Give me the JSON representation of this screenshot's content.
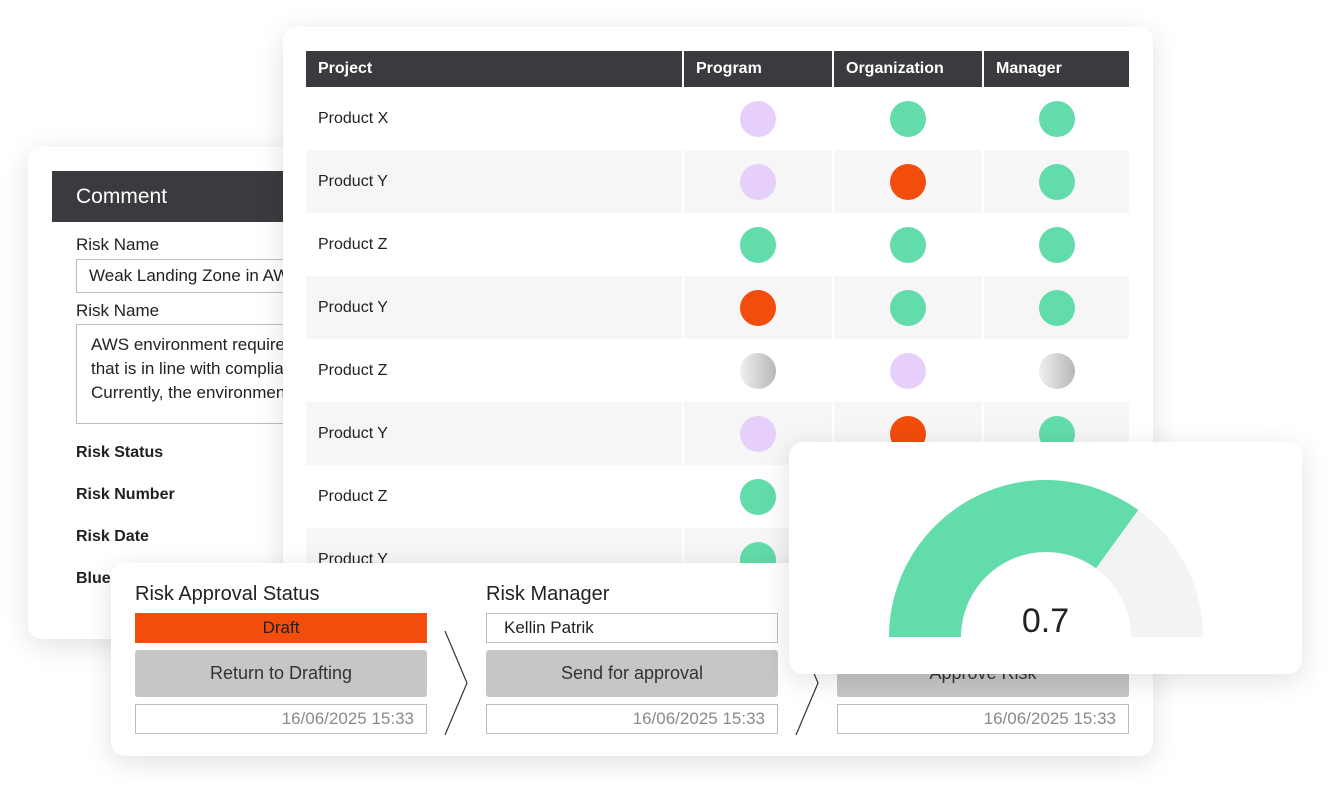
{
  "comment": {
    "header": "Comment",
    "risk_name_label": "Risk Name",
    "risk_name_value": "Weak Landing Zone in AWS",
    "description_label": "Risk Name",
    "description_lines": [
      "AWS environment requires a landing zone",
      "that is in line with compliance standards.",
      "Currently, the environment lacks this."
    ],
    "risk_status_label": "Risk Status",
    "risk_number_label": "Risk Number",
    "risk_date_label": "Risk Date",
    "blue_label": "Blue"
  },
  "table": {
    "headers": [
      "Project",
      "Program",
      "Organization",
      "Manager"
    ],
    "rows": [
      {
        "project": "Product X",
        "program": "lavender",
        "organization": "green",
        "manager": "green"
      },
      {
        "project": "Product Y",
        "program": "lavender",
        "organization": "orange",
        "manager": "green"
      },
      {
        "project": "Product Z",
        "program": "green",
        "organization": "green",
        "manager": "green"
      },
      {
        "project": "Product Y",
        "program": "orange",
        "organization": "green",
        "manager": "green"
      },
      {
        "project": "Product Z",
        "program": "grey",
        "organization": "lavender",
        "manager": "grey"
      },
      {
        "project": "Product Y",
        "program": "lavender",
        "organization": "orange",
        "manager": "green"
      },
      {
        "project": "Product Z",
        "program": "green",
        "organization": "",
        "manager": ""
      },
      {
        "project": "Product Y",
        "program": "green",
        "organization": "",
        "manager": ""
      }
    ]
  },
  "workflow": {
    "stage1": {
      "title": "Risk Approval Status",
      "status": "Draft",
      "button": "Return to Drafting",
      "date": "16/06/2025 15:33"
    },
    "stage2": {
      "title": "Risk Manager",
      "name": "Kellin Patrik",
      "button": "Send for approval",
      "date": "16/06/2025 15:33"
    },
    "stage3": {
      "button": "Approve Risk",
      "date": "16/06/2025 15:33"
    }
  },
  "gauge": {
    "value": 0.7,
    "value_label": "0.7"
  },
  "colors": {
    "green": "#62dcab",
    "orange": "#f24d0c",
    "lavender": "#e6d0fb",
    "grey": "#c2c2c2",
    "header_dark": "#3b3b3f",
    "button_grey": "#c6c6c6"
  }
}
